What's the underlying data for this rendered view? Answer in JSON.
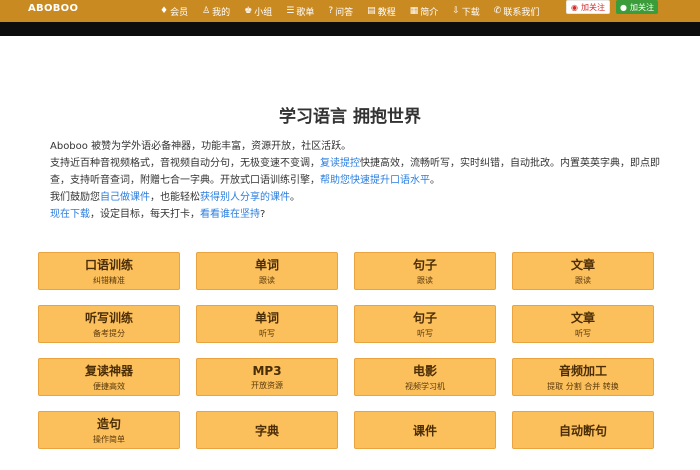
{
  "brand": "ABOBOO",
  "nav": [
    {
      "icon": "gem-icon",
      "glyph": "♦",
      "label": "会员"
    },
    {
      "icon": "user-icon",
      "glyph": "♙",
      "label": "我的"
    },
    {
      "icon": "group-icon",
      "glyph": "♚",
      "label": "小组"
    },
    {
      "icon": "list-icon",
      "glyph": "☰",
      "label": "歌单"
    },
    {
      "icon": "question-icon",
      "glyph": "?",
      "label": "问答"
    },
    {
      "icon": "book-icon",
      "glyph": "▤",
      "label": "教程"
    },
    {
      "icon": "doc-icon",
      "glyph": "▦",
      "label": "简介"
    },
    {
      "icon": "download-icon",
      "glyph": "⇩",
      "label": "下载"
    },
    {
      "icon": "phone-icon",
      "glyph": "✆",
      "label": "联系我们"
    }
  ],
  "follow": {
    "weibo": "加关注",
    "wechat": "加关注"
  },
  "title": "学习语言 拥抱世界",
  "intro": {
    "p1": "Aboboo 被赞为学外语必备神器，功能丰富，资源开放，社区活跃。",
    "p2a": "支持近百种音视频格式，音视频自动分句，无极变速不变调，",
    "p2_link": "复读提控",
    "p2b": "快捷高效，流畅听写，实时纠错，自动批改。内置英英字典，即点即查，支持听音查词，附赠七合一字典。开放式口语训练引擎，",
    "p2_link2": "帮助您快速提升口语水平",
    "p2c": "。",
    "p3a": "我们鼓励您",
    "p3_link1": "自己做课件",
    "p3b": "，也能轻松",
    "p3_link2": "获得别人分享的课件",
    "p3c": "。",
    "p4_link1": "现在下载",
    "p4b": "，设定目标，每天打卡，",
    "p4_link2": "看看谁在坚持",
    "p4c": "?"
  },
  "tiles": [
    {
      "title": "口语训练",
      "sub": "纠错精准"
    },
    {
      "title": "单词",
      "sub": "跟读"
    },
    {
      "title": "句子",
      "sub": "跟读"
    },
    {
      "title": "文章",
      "sub": "跟读"
    },
    {
      "title": "听写训练",
      "sub": "备考提分"
    },
    {
      "title": "单词",
      "sub": "听写"
    },
    {
      "title": "句子",
      "sub": "听写"
    },
    {
      "title": "文章",
      "sub": "听写"
    },
    {
      "title": "复读神器",
      "sub": "便捷高效"
    },
    {
      "title": "MP3",
      "sub": "开放资源"
    },
    {
      "title": "电影",
      "sub": "视频学习机"
    },
    {
      "title": "音频加工",
      "sub": "提取 分割 合并 转换"
    },
    {
      "title": "造句",
      "sub": "操作简单"
    },
    {
      "title": "字典",
      "sub": ""
    },
    {
      "title": "课件",
      "sub": ""
    },
    {
      "title": "自动断句",
      "sub": ""
    }
  ]
}
